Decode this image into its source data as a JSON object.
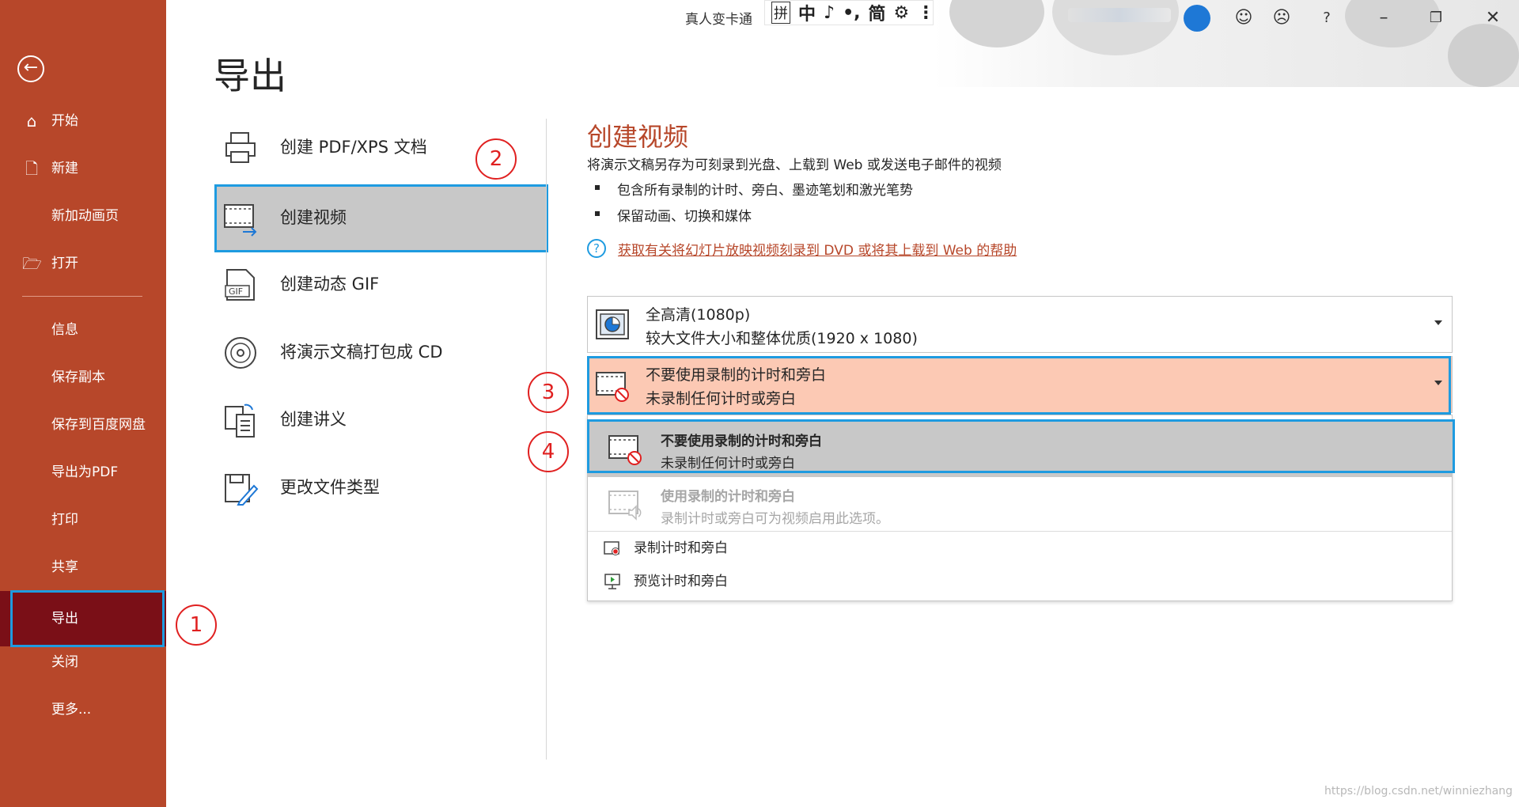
{
  "app": {
    "title": "真人变卡通",
    "ime": [
      "拼",
      "中",
      "♪",
      "•,",
      "简",
      "⚙",
      "⋮"
    ],
    "title_buttons": [
      "smile-icon",
      "frown-icon",
      "help-icon",
      "minimize-icon",
      "restore-icon",
      "close-icon"
    ],
    "help_label": "?"
  },
  "sidebar": {
    "items": [
      {
        "label": "开始",
        "icon": "home-icon"
      },
      {
        "label": "新建",
        "icon": "new-document-icon"
      },
      {
        "label": "新加动画页",
        "icon": ""
      },
      {
        "label": "打开",
        "icon": "open-folder-icon"
      },
      {
        "label": "信息",
        "icon": ""
      },
      {
        "label": "保存副本",
        "icon": ""
      },
      {
        "label": "保存到百度网盘",
        "icon": ""
      },
      {
        "label": "导出为PDF",
        "icon": ""
      },
      {
        "label": "打印",
        "icon": ""
      },
      {
        "label": "共享",
        "icon": ""
      },
      {
        "label": "导出",
        "icon": "",
        "active": true
      },
      {
        "label": "关闭",
        "icon": ""
      },
      {
        "label": "更多...",
        "icon": ""
      }
    ]
  },
  "page": {
    "title": "导出"
  },
  "export_options": [
    {
      "label": "创建 PDF/XPS 文档",
      "icon": "pdf-printer-icon"
    },
    {
      "label": "创建视频",
      "icon": "video-film-icon",
      "selected": true
    },
    {
      "label": "创建动态 GIF",
      "icon": "gif-icon"
    },
    {
      "label": "将演示文稿打包成 CD",
      "icon": "cd-icon"
    },
    {
      "label": "创建讲义",
      "icon": "handout-icon"
    },
    {
      "label": "更改文件类型",
      "icon": "change-file-type-icon"
    }
  ],
  "detail": {
    "title": "创建视频",
    "description": "将演示文稿另存为可刻录到光盘、上载到 Web 或发送电子邮件的视频",
    "bullets": [
      "包含所有录制的计时、旁白、墨迹笔划和激光笔势",
      "保留动画、切换和媒体"
    ],
    "help_link": "获取有关将幻灯片放映视频刻录到 DVD 或将其上载到 Web 的帮助",
    "quality": {
      "title": "全高清(1080p)",
      "subtitle": "较大文件大小和整体优质(1920 x 1080)"
    },
    "narration": {
      "title": "不要使用录制的计时和旁白",
      "subtitle": "未录制任何计时或旁白"
    },
    "menu": {
      "options": [
        {
          "title": "不要使用录制的计时和旁白",
          "subtitle": "未录制任何计时或旁白",
          "state": "highlighted"
        },
        {
          "title": "使用录制的计时和旁白",
          "subtitle": "录制计时或旁白可为视频启用此选项。",
          "state": "disabled"
        }
      ],
      "actions": [
        {
          "label": "录制计时和旁白",
          "icon": "record-icon"
        },
        {
          "label": "预览计时和旁白",
          "icon": "preview-icon"
        }
      ]
    }
  },
  "steps": [
    "1",
    "2",
    "3",
    "4"
  ],
  "colors": {
    "sidebar": "#b7472a",
    "sidebar_active": "#7a0f17",
    "accent_outline": "#1e9be0",
    "dropdown_open": "#fcc9b4",
    "step_marker": "#e02020"
  },
  "watermark": "https://blog.csdn.net/winniezhang"
}
